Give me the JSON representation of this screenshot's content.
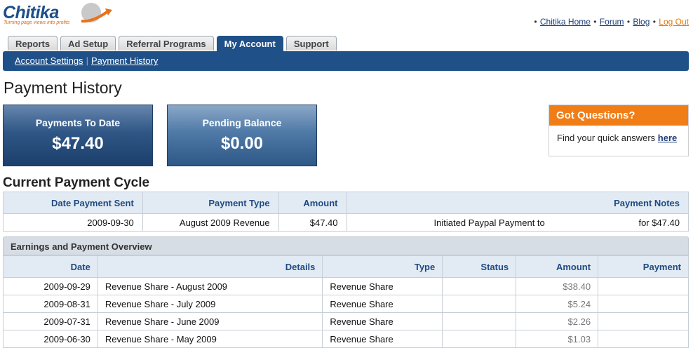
{
  "brand": {
    "name": "Chitika",
    "tagline": "Turning page views into profits"
  },
  "toplinks": {
    "home": "Chitika Home",
    "forum": "Forum",
    "blog": "Blog",
    "logout": "Log Out",
    "bullet": "•"
  },
  "tabs": [
    {
      "label": "Reports"
    },
    {
      "label": "Ad Setup"
    },
    {
      "label": "Referral Programs"
    },
    {
      "label": "My Account",
      "active": true
    },
    {
      "label": "Support"
    }
  ],
  "subnav": {
    "account_settings": "Account Settings",
    "payment_history": "Payment History"
  },
  "page_title": "Payment History",
  "summary": {
    "paid_label": "Payments To Date",
    "paid_value": "$47.40",
    "pending_label": "Pending Balance",
    "pending_value": "$0.00"
  },
  "questions": {
    "title": "Got Questions?",
    "text": "Find your quick answers ",
    "link": "here"
  },
  "current_cycle": {
    "title": "Current Payment Cycle",
    "headers": [
      "Date Payment Sent",
      "Payment Type",
      "Amount",
      "Payment Notes"
    ],
    "row": {
      "date": "2009-09-30",
      "type": "August 2009 Revenue",
      "amount": "$47.40",
      "notes_left": "Initiated Paypal Payment to",
      "notes_right": "for $47.40"
    }
  },
  "overview": {
    "title": "Earnings and Payment Overview",
    "headers": [
      "Date",
      "Details",
      "Type",
      "Status",
      "Amount",
      "Payment"
    ],
    "rows": [
      {
        "date": "2009-09-29",
        "details": "Revenue Share - August 2009",
        "type": "Revenue Share",
        "status": "",
        "amount": "$38.40",
        "payment": ""
      },
      {
        "date": "2009-08-31",
        "details": "Revenue Share - July 2009",
        "type": "Revenue Share",
        "status": "",
        "amount": "$5.24",
        "payment": ""
      },
      {
        "date": "2009-07-31",
        "details": "Revenue Share - June 2009",
        "type": "Revenue Share",
        "status": "",
        "amount": "$2.26",
        "payment": ""
      },
      {
        "date": "2009-06-30",
        "details": "Revenue Share - May 2009",
        "type": "Revenue Share",
        "status": "",
        "amount": "$1.03",
        "payment": ""
      }
    ]
  },
  "colors": {
    "brand_blue": "#1f5088",
    "accent_orange": "#f07d16",
    "header_text": "#1f4a80"
  }
}
